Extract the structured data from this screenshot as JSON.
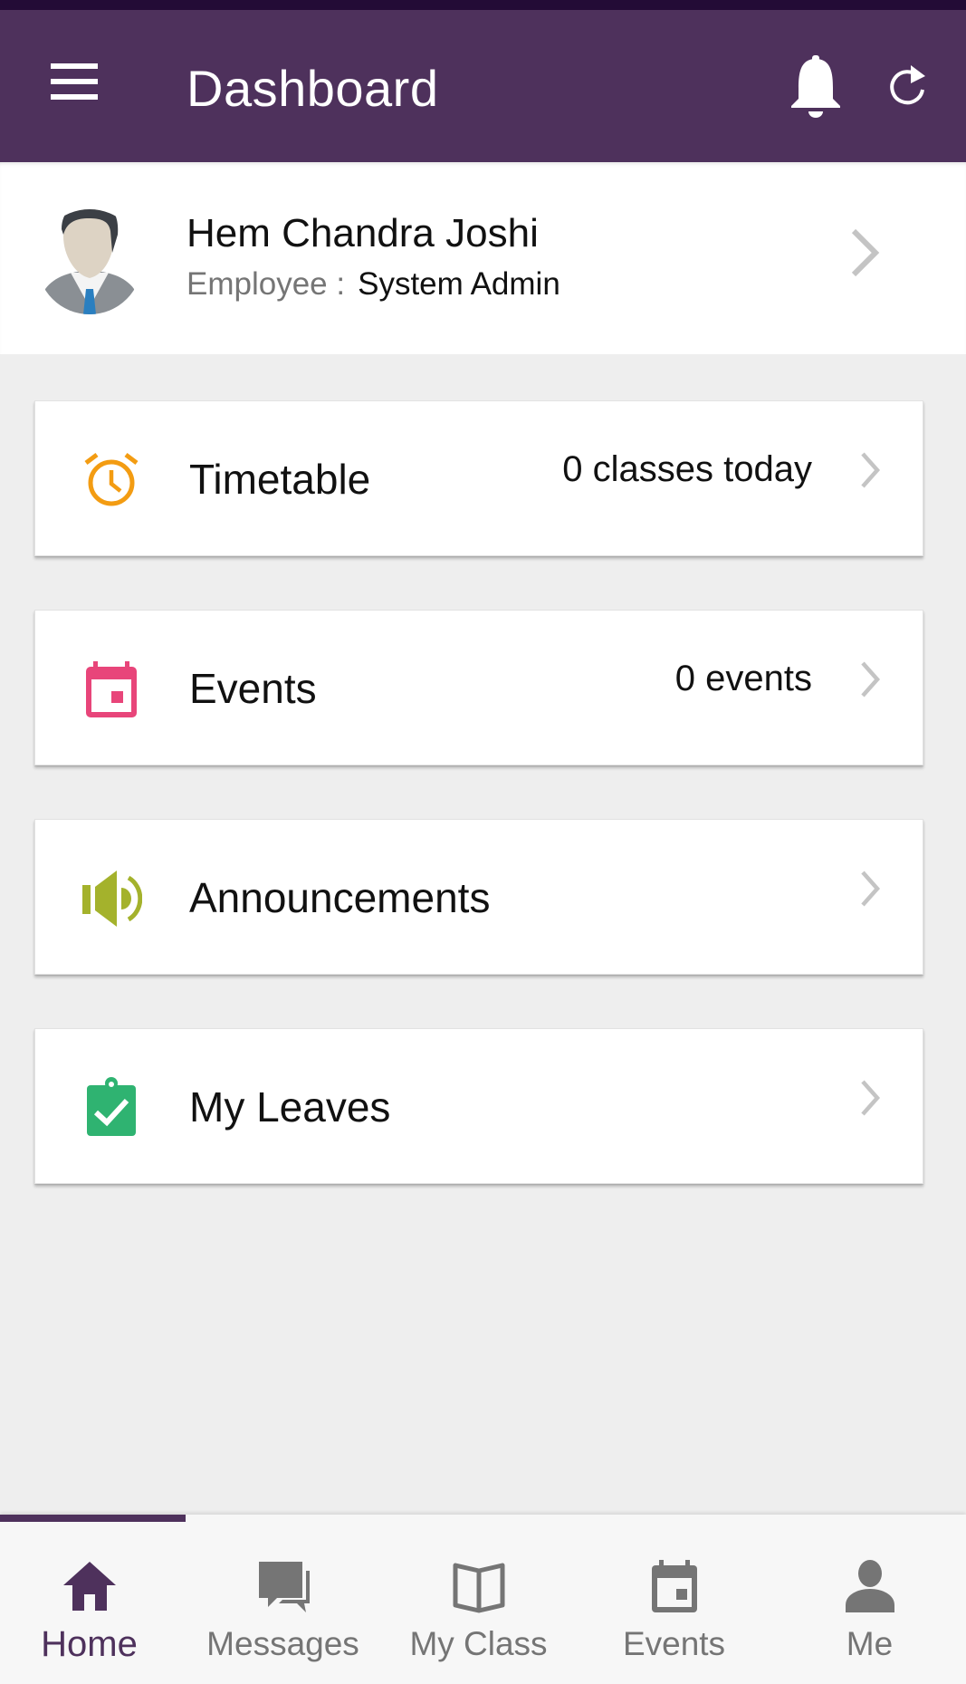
{
  "colors": {
    "primary": "#4e315c",
    "status_bar": "#230b36",
    "timetable_icon": "#f39c12",
    "events_icon": "#e8457a",
    "announcements_icon": "#a4b22c",
    "leaves_icon": "#2fb371",
    "inactive_tab": "#757575"
  },
  "appbar": {
    "title": "Dashboard",
    "menu_icon": "hamburger-menu-icon",
    "notification_icon": "bell-icon",
    "refresh_icon": "refresh-icon"
  },
  "profile": {
    "name": "Hem Chandra Joshi",
    "role_label": "Employee :",
    "role_value": "System Admin",
    "avatar_icon": "user-avatar"
  },
  "cards": [
    {
      "label": "Timetable",
      "info": "0 classes today",
      "icon": "alarm-clock-icon"
    },
    {
      "label": "Events",
      "info": "0 events",
      "icon": "calendar-icon"
    },
    {
      "label": "Announcements",
      "info": "",
      "icon": "megaphone-icon"
    },
    {
      "label": "My Leaves",
      "info": "",
      "icon": "clipboard-check-icon"
    }
  ],
  "bottom_nav": {
    "active": "Home",
    "tabs": [
      {
        "label": "Home",
        "icon": "home-icon"
      },
      {
        "label": "Messages",
        "icon": "chat-bubbles-icon"
      },
      {
        "label": "My Class",
        "icon": "open-book-icon"
      },
      {
        "label": "Events",
        "icon": "calendar-icon"
      },
      {
        "label": "Me",
        "icon": "person-icon"
      }
    ]
  }
}
